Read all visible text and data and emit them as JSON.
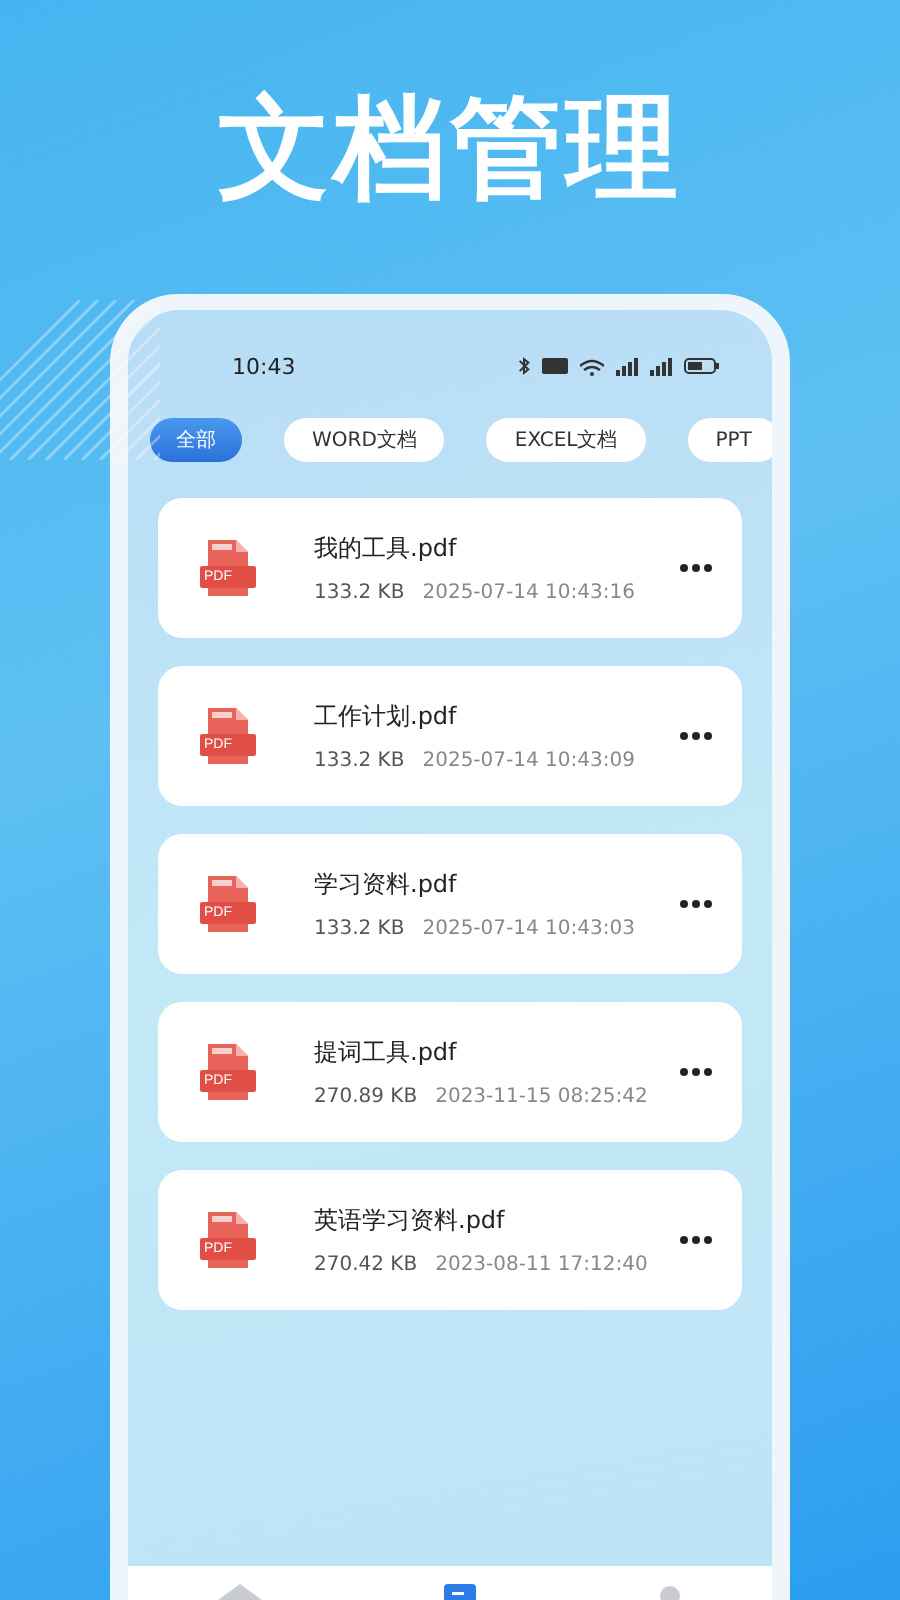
{
  "headline": "文档管理",
  "status_bar": {
    "time": "10:43"
  },
  "tabs": [
    {
      "label": "全部",
      "selected": true
    },
    {
      "label": "WORD文档",
      "selected": false
    },
    {
      "label": "EXCEL文档",
      "selected": false
    },
    {
      "label": "PPT",
      "selected": false
    }
  ],
  "files": [
    {
      "icon_label": "PDF",
      "name": "我的工具.pdf",
      "size": "133.2 KB",
      "date": "2025-07-14 10:43:16"
    },
    {
      "icon_label": "PDF",
      "name": "工作计划.pdf",
      "size": "133.2 KB",
      "date": "2025-07-14 10:43:09"
    },
    {
      "icon_label": "PDF",
      "name": "学习资料.pdf",
      "size": "133.2 KB",
      "date": "2025-07-14 10:43:03"
    },
    {
      "icon_label": "PDF",
      "name": "提词工具.pdf",
      "size": "270.89 KB",
      "date": "2023-11-15 08:25:42"
    },
    {
      "icon_label": "PDF",
      "name": "英语学习资料.pdf",
      "size": "270.42 KB",
      "date": "2023-08-11 17:12:40"
    }
  ],
  "bottom_nav": [
    {
      "kind": "home",
      "selected": false
    },
    {
      "kind": "files",
      "selected": true
    },
    {
      "kind": "profile",
      "selected": false
    }
  ]
}
